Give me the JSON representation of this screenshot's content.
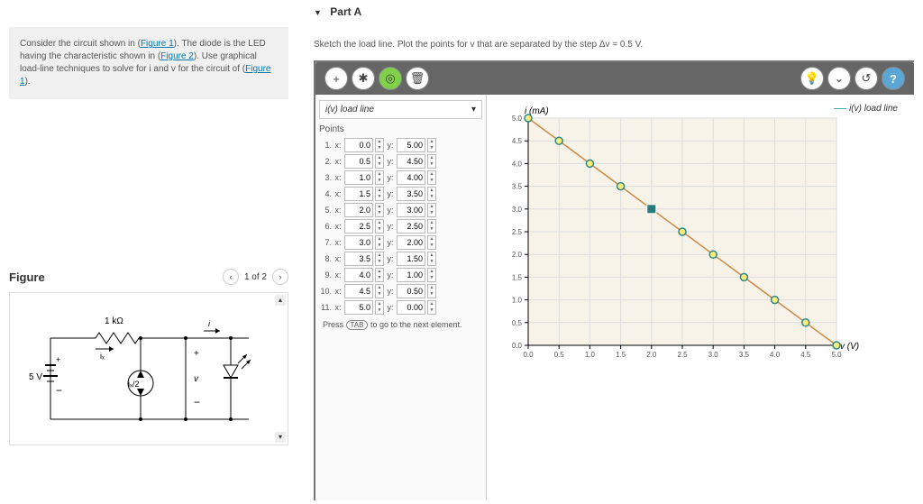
{
  "problem": {
    "text_before_fig1": "Consider the circuit shown in (",
    "fig1_label": "Figure 1",
    "text_mid1": "). The diode is the LED having the characteristic shown in (",
    "fig2_label": "Figure 2",
    "text_mid2": "). Use graphical load-line techniques to solve for i and v for the circuit of (",
    "fig1_label2": "Figure 1",
    "text_end": ")."
  },
  "figure": {
    "title": "Figure",
    "pager": "1 of 2",
    "r_label": "1 kΩ",
    "v_src": "5 V",
    "ix": "iₓ",
    "ix2": "iₓ/2",
    "i_lbl": "i",
    "v_lbl": "v"
  },
  "part": {
    "title": "Part A",
    "instruction": "Sketch the load line. Plot the points for v that are separated by the step Δv = 0.5 V."
  },
  "toolbar": {
    "add": "+",
    "nopt": "✱",
    "target": "◎",
    "trash": "🗑",
    "bulb": "💡",
    "down": "⌄",
    "undo": "↺",
    "help": "?"
  },
  "series": {
    "name": "i(v) load line"
  },
  "points_label": "Points",
  "points": [
    {
      "idx": "1.",
      "x": "0.0",
      "y": "5.00"
    },
    {
      "idx": "2.",
      "x": "0.5",
      "y": "4.50"
    },
    {
      "idx": "3.",
      "x": "1.0",
      "y": "4.00"
    },
    {
      "idx": "4.",
      "x": "1.5",
      "y": "3.50"
    },
    {
      "idx": "5.",
      "x": "2.0",
      "y": "3.00"
    },
    {
      "idx": "6.",
      "x": "2.5",
      "y": "2.50"
    },
    {
      "idx": "7.",
      "x": "3.0",
      "y": "2.00"
    },
    {
      "idx": "8.",
      "x": "3.5",
      "y": "1.50"
    },
    {
      "idx": "9.",
      "x": "4.0",
      "y": "1.00"
    },
    {
      "idx": "10.",
      "x": "4.5",
      "y": "0.50"
    },
    {
      "idx": "11.",
      "x": "5.0",
      "y": "0.00"
    }
  ],
  "tab_hint": {
    "pre": "Press ",
    "key": "TAB",
    "post": " to go to the next element."
  },
  "legend": "i(v) load line",
  "chart_data": {
    "type": "line",
    "x": [
      0.0,
      0.5,
      1.0,
      1.5,
      2.0,
      2.5,
      3.0,
      3.5,
      4.0,
      4.5,
      5.0
    ],
    "y": [
      5.0,
      4.5,
      4.0,
      3.5,
      3.0,
      2.5,
      2.0,
      1.5,
      1.0,
      0.5,
      0.0
    ],
    "xlabel": "v (V)",
    "ylabel": "i (mA)",
    "xlim": [
      0,
      5
    ],
    "ylim": [
      0,
      5
    ],
    "xticks": [
      "0.0",
      "0.5",
      "1.0",
      "1.5",
      "2.0",
      "2.5",
      "3.0",
      "3.5",
      "4.0",
      "4.5",
      "5.0"
    ],
    "yticks": [
      "0.0",
      "0.5",
      "1.0",
      "1.5",
      "2.0",
      "2.5",
      "3.0",
      "3.5",
      "4.0",
      "4.5",
      "5.0"
    ]
  }
}
